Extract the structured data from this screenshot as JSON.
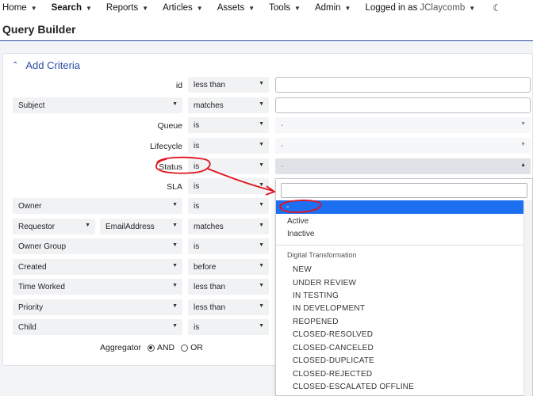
{
  "nav": {
    "items": [
      {
        "label": "Home"
      },
      {
        "label": "Search"
      },
      {
        "label": "Reports"
      },
      {
        "label": "Articles"
      },
      {
        "label": "Assets"
      },
      {
        "label": "Tools"
      },
      {
        "label": "Admin"
      }
    ],
    "logged_in_prefix": "Logged in as",
    "user": "JClaycomb"
  },
  "page_title": "Query Builder",
  "criteria": {
    "heading": "Add Criteria",
    "rows": {
      "id": {
        "label": "id",
        "op": "less than"
      },
      "subject": {
        "field": "Subject",
        "op": "matches"
      },
      "queue": {
        "label": "Queue",
        "op": "is",
        "value": "-"
      },
      "lifecycle": {
        "label": "Lifecycle",
        "op": "is",
        "value": "-"
      },
      "status": {
        "label": "Status",
        "op": "is",
        "value": "-"
      },
      "sla": {
        "label": "SLA",
        "op": "is"
      },
      "owner": {
        "field": "Owner",
        "op": "is"
      },
      "requestor": {
        "field": "Requestor",
        "subfield": "EmailAddress",
        "op": "matches"
      },
      "owner_group": {
        "field": "Owner Group",
        "op": "is"
      },
      "created": {
        "field": "Created",
        "op": "before"
      },
      "time_worked": {
        "field": "Time Worked",
        "op": "less than"
      },
      "priority": {
        "field": "Priority",
        "op": "less than"
      },
      "child": {
        "field": "Child",
        "op": "is"
      }
    },
    "aggregator": {
      "label": "Aggregator",
      "and": "AND",
      "or": "OR",
      "selected": "AND"
    }
  },
  "status_dropdown": {
    "highlighted": "-",
    "options": [
      "Active",
      "Inactive"
    ],
    "group": "Digital Transformation",
    "group_options": [
      "NEW",
      "UNDER REVIEW",
      "IN TESTING",
      "IN DEVELOPMENT",
      "REOPENED",
      "CLOSED-RESOLVED",
      "CLOSED-CANCELED",
      "CLOSED-DUPLICATE",
      "CLOSED-REJECTED",
      "CLOSED-ESCALATED OFFLINE"
    ]
  },
  "colors": {
    "accent": "#2c4ca0",
    "highlight": "#1d6ff2",
    "annotation": "#e0141e"
  }
}
